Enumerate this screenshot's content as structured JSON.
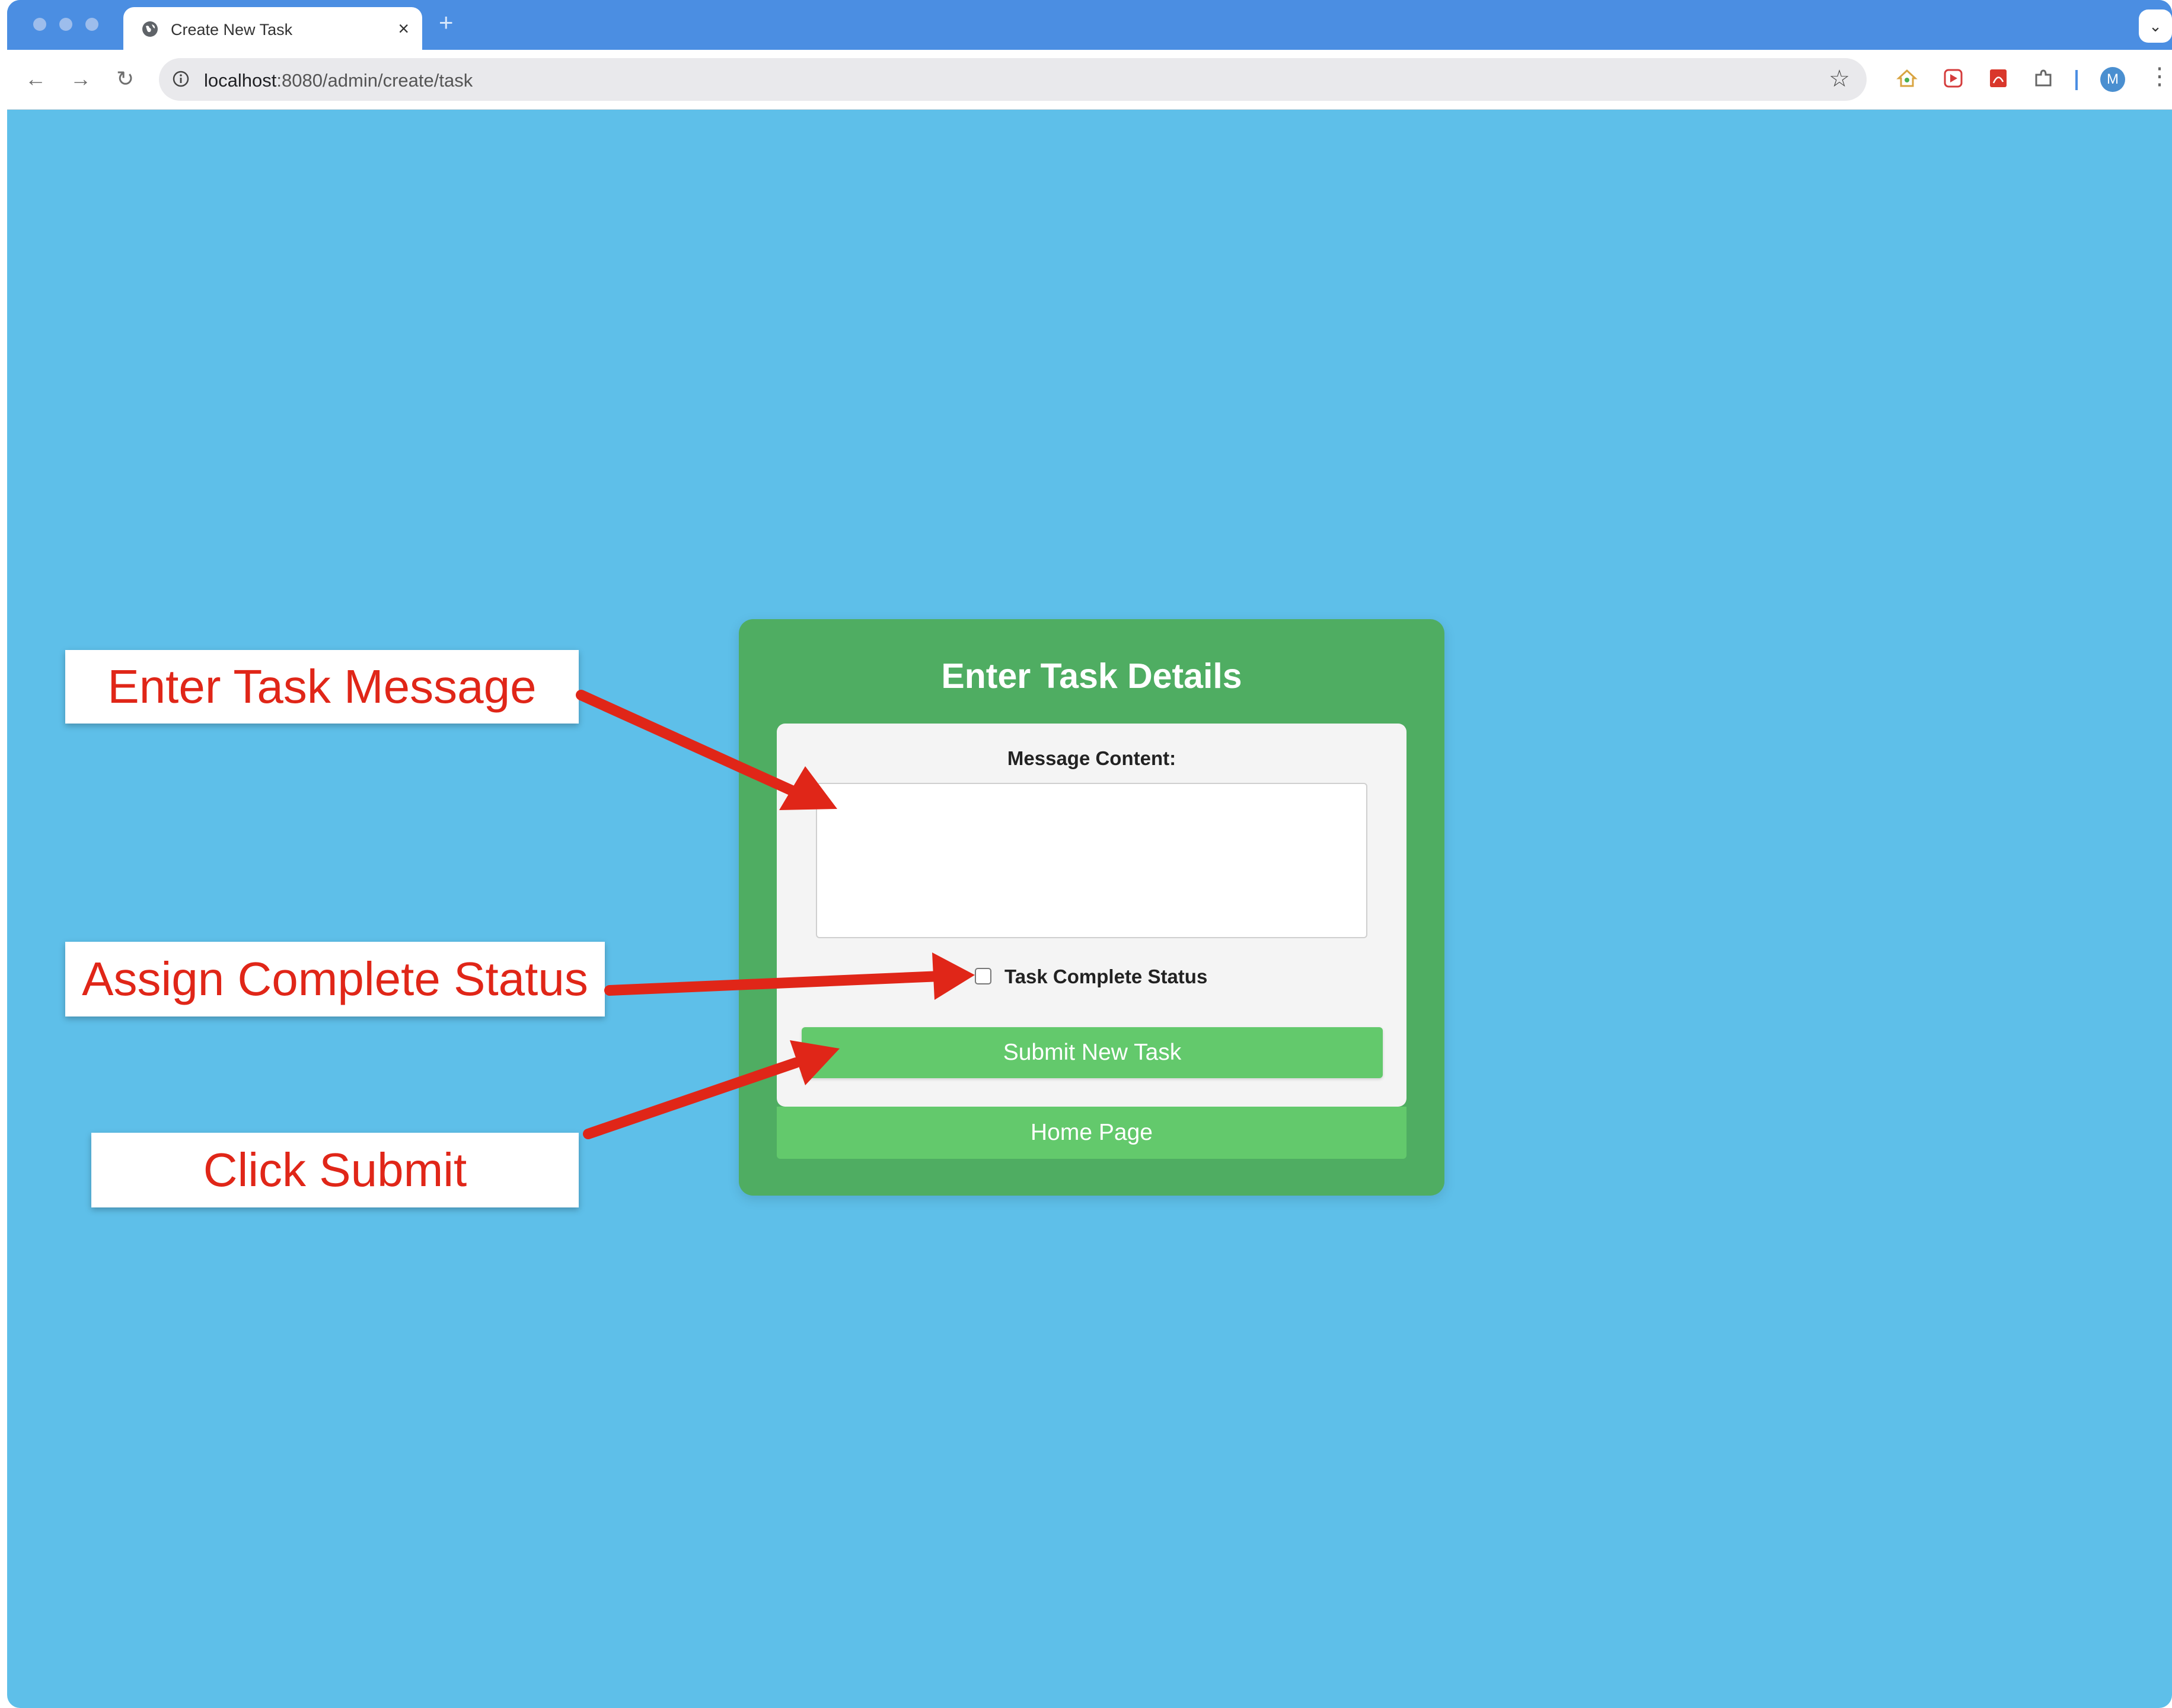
{
  "browser": {
    "tab_title": "Create New Task",
    "tab_close": "×",
    "new_tab": "+",
    "url_host": "localhost",
    "url_rest": ":8080/admin/create/task",
    "avatar_letter": "M"
  },
  "form": {
    "title": "Enter Task Details",
    "message_label": "Message Content:",
    "message_value": "",
    "status_label": "Task Complete Status",
    "status_checked": false,
    "submit_label": "Submit New Task",
    "home_label": "Home Page"
  },
  "annotations": {
    "message": "Enter Task Message",
    "status": "Assign Complete Status",
    "submit": "Click Submit"
  },
  "colors": {
    "page_bg": "#5ebfe9",
    "card_bg": "#4fad62",
    "button_bg": "#63c96c",
    "annotation": "#e02618",
    "tabstrip": "#4b8ee2"
  },
  "icons": [
    "globe-icon",
    "info-icon",
    "star-icon",
    "back-icon",
    "forward-icon",
    "reload-icon",
    "extension-icon",
    "more-icon"
  ]
}
